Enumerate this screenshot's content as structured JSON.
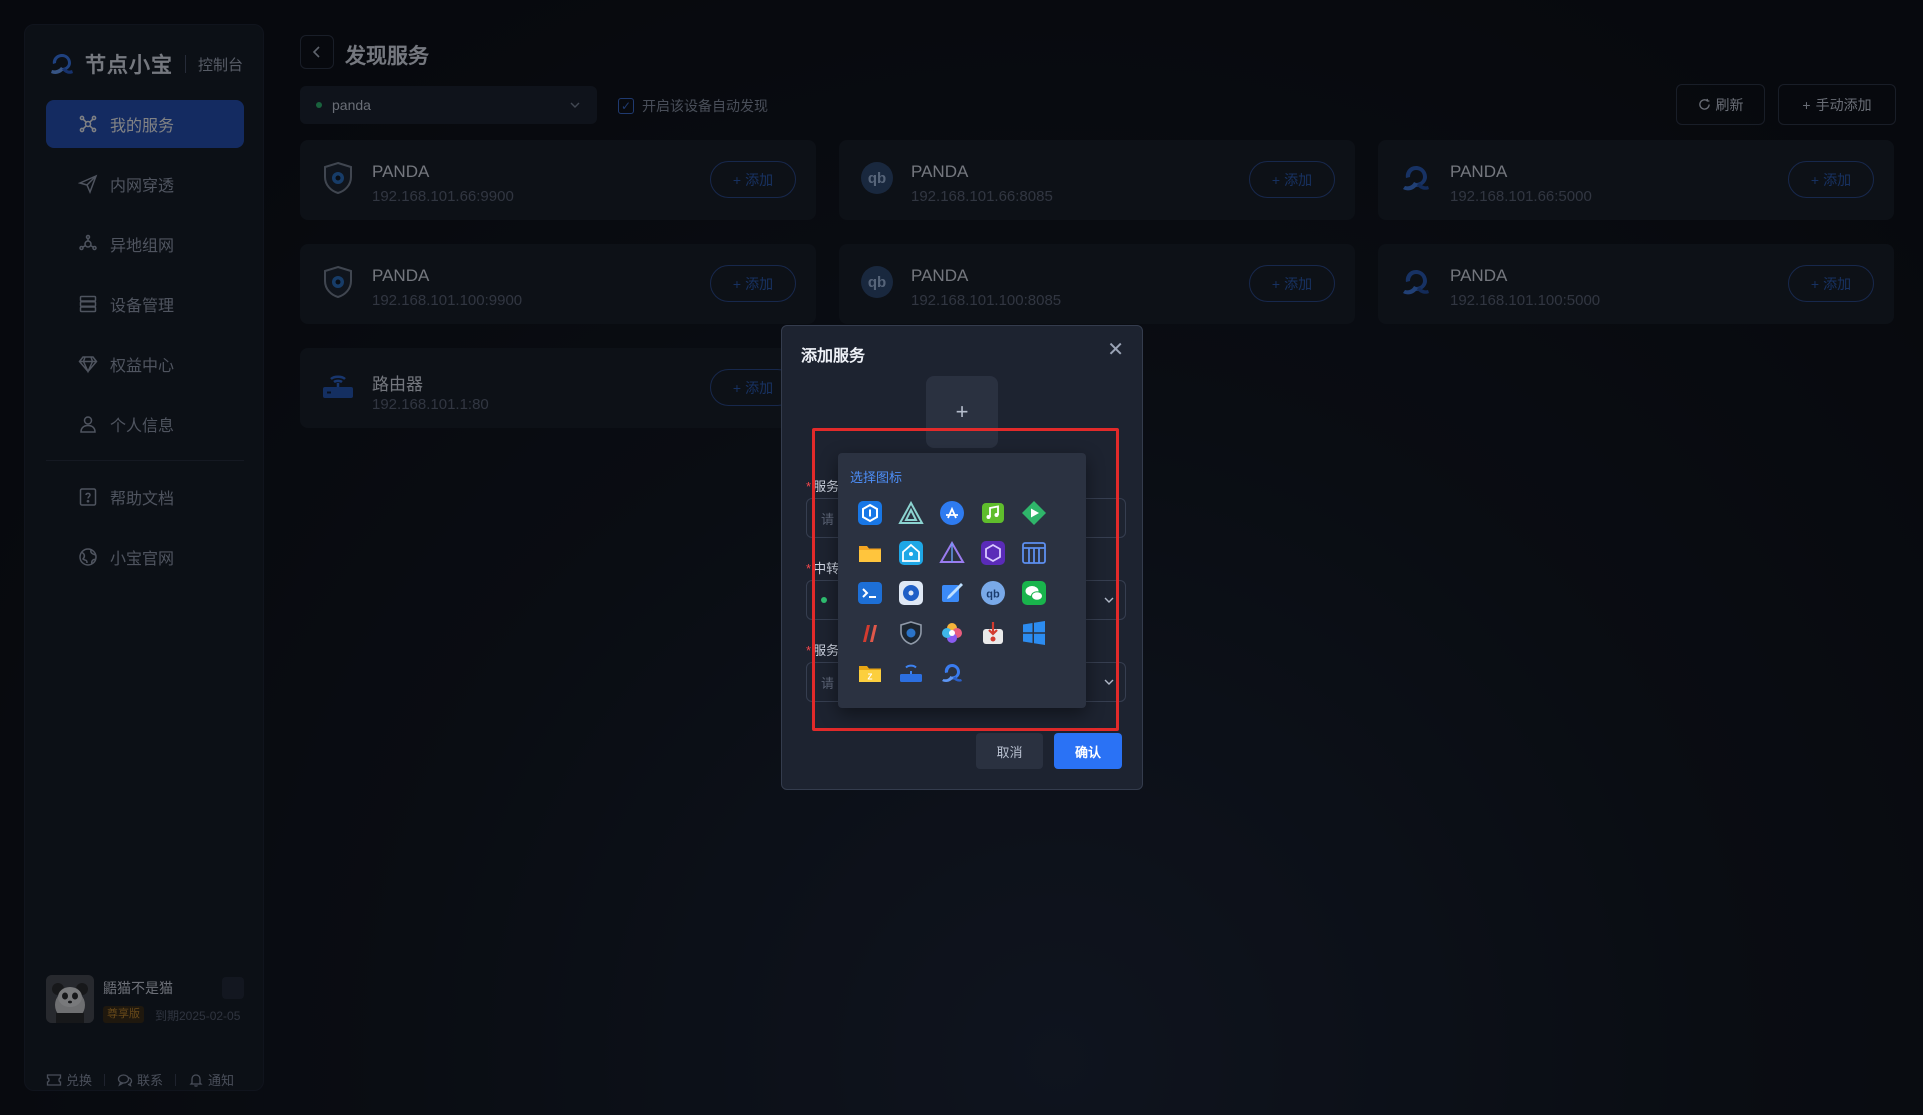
{
  "brand": {
    "name": "节点小宝",
    "sub": "控制台"
  },
  "nav": [
    {
      "label": "我的服务",
      "icon": "services-icon",
      "active": true
    },
    {
      "label": "内网穿透",
      "icon": "send-icon"
    },
    {
      "label": "异地组网",
      "icon": "network-icon"
    },
    {
      "label": "设备管理",
      "icon": "devices-icon"
    },
    {
      "label": "权益中心",
      "icon": "diamond-icon"
    },
    {
      "label": "个人信息",
      "icon": "user-icon"
    },
    {
      "label": "帮助文档",
      "icon": "help-icon"
    },
    {
      "label": "小宝官网",
      "icon": "globe-icon"
    }
  ],
  "user": {
    "name": "鼯猫不是猫",
    "role": "尊享版",
    "expiry": "到期2025-02-05"
  },
  "footer_links": {
    "exchange": "兑换",
    "contact": "联系",
    "notify": "通知"
  },
  "page": {
    "title": "发现服务",
    "device": "panda",
    "auto_discover": "开启该设备自动发现",
    "refresh": "刷新",
    "manual_add": "手动添加"
  },
  "cards": [
    {
      "name": "PANDA",
      "addr": "192.168.101.66:9900",
      "icon": "shield-icon",
      "add": "添加"
    },
    {
      "name": "PANDA",
      "addr": "192.168.101.66:8085",
      "icon": "qbittorrent-icon",
      "add": "添加"
    },
    {
      "name": "PANDA",
      "addr": "192.168.101.66:5000",
      "icon": "node-logo-icon",
      "add": "添加"
    },
    {
      "name": "PANDA",
      "addr": "192.168.101.100:9900",
      "icon": "shield-icon",
      "add": "添加"
    },
    {
      "name": "PANDA",
      "addr": "192.168.101.100:8085",
      "icon": "qbittorrent-icon",
      "add": "添加"
    },
    {
      "name": "PANDA",
      "addr": "192.168.101.100:5000",
      "icon": "node-logo-icon",
      "add": "添加"
    },
    {
      "name": "路由器",
      "addr": "192.168.101.1:80",
      "icon": "router-icon",
      "add": "添加"
    }
  ],
  "modal": {
    "title": "添加服务",
    "label_name": "服务",
    "placeholder_name": "请",
    "label_relay": "中转",
    "label_addr": "服务",
    "placeholder_addr": "请",
    "cancel": "取消",
    "confirm": "确认",
    "picker_title": "选择图标"
  }
}
